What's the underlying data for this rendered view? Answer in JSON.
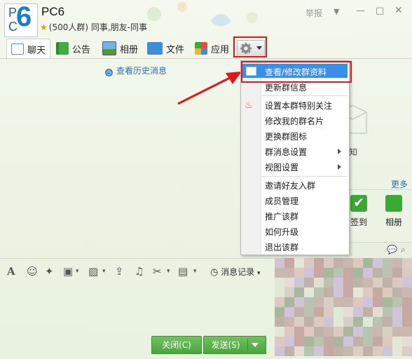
{
  "header": {
    "logo_p": "P",
    "logo_c": "C",
    "logo_6": "6",
    "title": "PC6",
    "meta": "(500人群) 同事,朋友-同事",
    "report": "举报"
  },
  "tabs": [
    {
      "label": "聊天",
      "icon": "chat-icon"
    },
    {
      "label": "公告",
      "icon": "flag-icon"
    },
    {
      "label": "相册",
      "icon": "photo-icon"
    },
    {
      "label": "文件",
      "icon": "folder-icon"
    },
    {
      "label": "应用",
      "icon": "apps-icon"
    }
  ],
  "history_link": "查看历史消息",
  "menu": {
    "items": [
      {
        "label": "查看/修改群资料",
        "selected": true
      },
      {
        "label": "更新群信息"
      },
      {
        "label": "设置本群特别关注"
      },
      {
        "label": "修改我的群名片"
      },
      {
        "label": "更换群图标"
      },
      {
        "label": "群消息设置",
        "submenu": true
      },
      {
        "label": "视图设置",
        "submenu": true
      },
      {
        "label": "邀请好友入群"
      },
      {
        "label": "成员管理"
      },
      {
        "label": "推广该群"
      },
      {
        "label": "如何升级"
      },
      {
        "label": "退出该群"
      }
    ]
  },
  "right_panel": {
    "notice_label": "知",
    "more": "更多",
    "apps": [
      {
        "label": "签到",
        "color": "#3aa935"
      },
      {
        "label": "相册",
        "color": "#3aa935"
      }
    ]
  },
  "toolbar": {
    "message_record": "消息记录"
  },
  "buttons": {
    "close": "关闭(C)",
    "send": "发送(S)"
  },
  "colors": {
    "accent_green": "#4aa63c",
    "highlight_red": "#e0161b",
    "menu_selected": "#3b8ee6"
  }
}
